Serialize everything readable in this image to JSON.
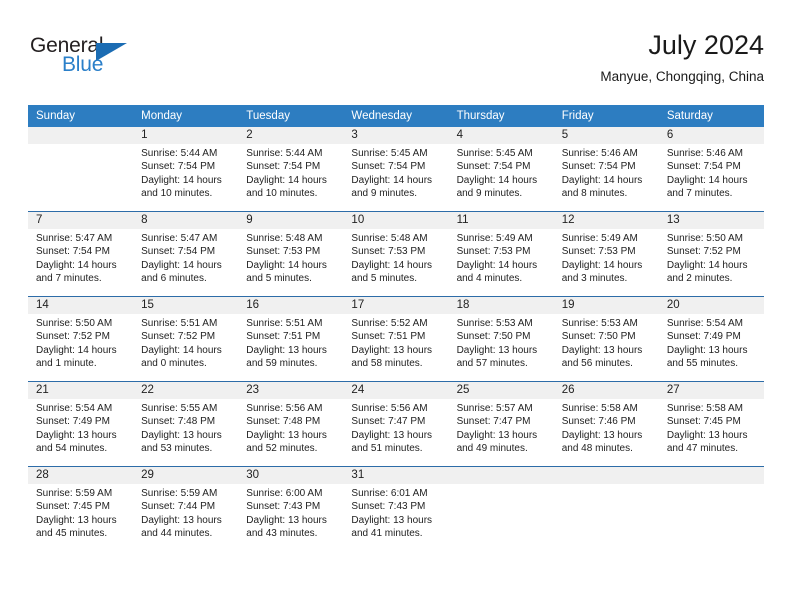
{
  "brand": {
    "name_part1": "General",
    "name_part2": "Blue",
    "triangle_icon": "brand-triangle-icon",
    "color_dark": "#231f20",
    "color_blue": "#2a7fc9"
  },
  "header": {
    "title": "July 2024",
    "subtitle": "Manyue, Chongqing, China"
  },
  "theme": {
    "header_bg": "#2d7dc1",
    "row_divider": "#2d6ca8",
    "daynum_band_bg": "#f0f0f0",
    "text": "#222222"
  },
  "weekdays": [
    "Sunday",
    "Monday",
    "Tuesday",
    "Wednesday",
    "Thursday",
    "Friday",
    "Saturday"
  ],
  "weeks": [
    [
      {
        "day": "",
        "sunrise": "",
        "sunset": "",
        "daylight_line1": "",
        "daylight_line2": "",
        "empty": true
      },
      {
        "day": "1",
        "sunrise": "Sunrise: 5:44 AM",
        "sunset": "Sunset: 7:54 PM",
        "daylight_line1": "Daylight: 14 hours",
        "daylight_line2": "and 10 minutes.",
        "empty": false
      },
      {
        "day": "2",
        "sunrise": "Sunrise: 5:44 AM",
        "sunset": "Sunset: 7:54 PM",
        "daylight_line1": "Daylight: 14 hours",
        "daylight_line2": "and 10 minutes.",
        "empty": false
      },
      {
        "day": "3",
        "sunrise": "Sunrise: 5:45 AM",
        "sunset": "Sunset: 7:54 PM",
        "daylight_line1": "Daylight: 14 hours",
        "daylight_line2": "and 9 minutes.",
        "empty": false
      },
      {
        "day": "4",
        "sunrise": "Sunrise: 5:45 AM",
        "sunset": "Sunset: 7:54 PM",
        "daylight_line1": "Daylight: 14 hours",
        "daylight_line2": "and 9 minutes.",
        "empty": false
      },
      {
        "day": "5",
        "sunrise": "Sunrise: 5:46 AM",
        "sunset": "Sunset: 7:54 PM",
        "daylight_line1": "Daylight: 14 hours",
        "daylight_line2": "and 8 minutes.",
        "empty": false
      },
      {
        "day": "6",
        "sunrise": "Sunrise: 5:46 AM",
        "sunset": "Sunset: 7:54 PM",
        "daylight_line1": "Daylight: 14 hours",
        "daylight_line2": "and 7 minutes.",
        "empty": false
      }
    ],
    [
      {
        "day": "7",
        "sunrise": "Sunrise: 5:47 AM",
        "sunset": "Sunset: 7:54 PM",
        "daylight_line1": "Daylight: 14 hours",
        "daylight_line2": "and 7 minutes.",
        "empty": false
      },
      {
        "day": "8",
        "sunrise": "Sunrise: 5:47 AM",
        "sunset": "Sunset: 7:54 PM",
        "daylight_line1": "Daylight: 14 hours",
        "daylight_line2": "and 6 minutes.",
        "empty": false
      },
      {
        "day": "9",
        "sunrise": "Sunrise: 5:48 AM",
        "sunset": "Sunset: 7:53 PM",
        "daylight_line1": "Daylight: 14 hours",
        "daylight_line2": "and 5 minutes.",
        "empty": false
      },
      {
        "day": "10",
        "sunrise": "Sunrise: 5:48 AM",
        "sunset": "Sunset: 7:53 PM",
        "daylight_line1": "Daylight: 14 hours",
        "daylight_line2": "and 5 minutes.",
        "empty": false
      },
      {
        "day": "11",
        "sunrise": "Sunrise: 5:49 AM",
        "sunset": "Sunset: 7:53 PM",
        "daylight_line1": "Daylight: 14 hours",
        "daylight_line2": "and 4 minutes.",
        "empty": false
      },
      {
        "day": "12",
        "sunrise": "Sunrise: 5:49 AM",
        "sunset": "Sunset: 7:53 PM",
        "daylight_line1": "Daylight: 14 hours",
        "daylight_line2": "and 3 minutes.",
        "empty": false
      },
      {
        "day": "13",
        "sunrise": "Sunrise: 5:50 AM",
        "sunset": "Sunset: 7:52 PM",
        "daylight_line1": "Daylight: 14 hours",
        "daylight_line2": "and 2 minutes.",
        "empty": false
      }
    ],
    [
      {
        "day": "14",
        "sunrise": "Sunrise: 5:50 AM",
        "sunset": "Sunset: 7:52 PM",
        "daylight_line1": "Daylight: 14 hours",
        "daylight_line2": "and 1 minute.",
        "empty": false
      },
      {
        "day": "15",
        "sunrise": "Sunrise: 5:51 AM",
        "sunset": "Sunset: 7:52 PM",
        "daylight_line1": "Daylight: 14 hours",
        "daylight_line2": "and 0 minutes.",
        "empty": false
      },
      {
        "day": "16",
        "sunrise": "Sunrise: 5:51 AM",
        "sunset": "Sunset: 7:51 PM",
        "daylight_line1": "Daylight: 13 hours",
        "daylight_line2": "and 59 minutes.",
        "empty": false
      },
      {
        "day": "17",
        "sunrise": "Sunrise: 5:52 AM",
        "sunset": "Sunset: 7:51 PM",
        "daylight_line1": "Daylight: 13 hours",
        "daylight_line2": "and 58 minutes.",
        "empty": false
      },
      {
        "day": "18",
        "sunrise": "Sunrise: 5:53 AM",
        "sunset": "Sunset: 7:50 PM",
        "daylight_line1": "Daylight: 13 hours",
        "daylight_line2": "and 57 minutes.",
        "empty": false
      },
      {
        "day": "19",
        "sunrise": "Sunrise: 5:53 AM",
        "sunset": "Sunset: 7:50 PM",
        "daylight_line1": "Daylight: 13 hours",
        "daylight_line2": "and 56 minutes.",
        "empty": false
      },
      {
        "day": "20",
        "sunrise": "Sunrise: 5:54 AM",
        "sunset": "Sunset: 7:49 PM",
        "daylight_line1": "Daylight: 13 hours",
        "daylight_line2": "and 55 minutes.",
        "empty": false
      }
    ],
    [
      {
        "day": "21",
        "sunrise": "Sunrise: 5:54 AM",
        "sunset": "Sunset: 7:49 PM",
        "daylight_line1": "Daylight: 13 hours",
        "daylight_line2": "and 54 minutes.",
        "empty": false
      },
      {
        "day": "22",
        "sunrise": "Sunrise: 5:55 AM",
        "sunset": "Sunset: 7:48 PM",
        "daylight_line1": "Daylight: 13 hours",
        "daylight_line2": "and 53 minutes.",
        "empty": false
      },
      {
        "day": "23",
        "sunrise": "Sunrise: 5:56 AM",
        "sunset": "Sunset: 7:48 PM",
        "daylight_line1": "Daylight: 13 hours",
        "daylight_line2": "and 52 minutes.",
        "empty": false
      },
      {
        "day": "24",
        "sunrise": "Sunrise: 5:56 AM",
        "sunset": "Sunset: 7:47 PM",
        "daylight_line1": "Daylight: 13 hours",
        "daylight_line2": "and 51 minutes.",
        "empty": false
      },
      {
        "day": "25",
        "sunrise": "Sunrise: 5:57 AM",
        "sunset": "Sunset: 7:47 PM",
        "daylight_line1": "Daylight: 13 hours",
        "daylight_line2": "and 49 minutes.",
        "empty": false
      },
      {
        "day": "26",
        "sunrise": "Sunrise: 5:58 AM",
        "sunset": "Sunset: 7:46 PM",
        "daylight_line1": "Daylight: 13 hours",
        "daylight_line2": "and 48 minutes.",
        "empty": false
      },
      {
        "day": "27",
        "sunrise": "Sunrise: 5:58 AM",
        "sunset": "Sunset: 7:45 PM",
        "daylight_line1": "Daylight: 13 hours",
        "daylight_line2": "and 47 minutes.",
        "empty": false
      }
    ],
    [
      {
        "day": "28",
        "sunrise": "Sunrise: 5:59 AM",
        "sunset": "Sunset: 7:45 PM",
        "daylight_line1": "Daylight: 13 hours",
        "daylight_line2": "and 45 minutes.",
        "empty": false
      },
      {
        "day": "29",
        "sunrise": "Sunrise: 5:59 AM",
        "sunset": "Sunset: 7:44 PM",
        "daylight_line1": "Daylight: 13 hours",
        "daylight_line2": "and 44 minutes.",
        "empty": false
      },
      {
        "day": "30",
        "sunrise": "Sunrise: 6:00 AM",
        "sunset": "Sunset: 7:43 PM",
        "daylight_line1": "Daylight: 13 hours",
        "daylight_line2": "and 43 minutes.",
        "empty": false
      },
      {
        "day": "31",
        "sunrise": "Sunrise: 6:01 AM",
        "sunset": "Sunset: 7:43 PM",
        "daylight_line1": "Daylight: 13 hours",
        "daylight_line2": "and 41 minutes.",
        "empty": false
      },
      {
        "day": "",
        "sunrise": "",
        "sunset": "",
        "daylight_line1": "",
        "daylight_line2": "",
        "empty": true
      },
      {
        "day": "",
        "sunrise": "",
        "sunset": "",
        "daylight_line1": "",
        "daylight_line2": "",
        "empty": true
      },
      {
        "day": "",
        "sunrise": "",
        "sunset": "",
        "daylight_line1": "",
        "daylight_line2": "",
        "empty": true
      }
    ]
  ]
}
